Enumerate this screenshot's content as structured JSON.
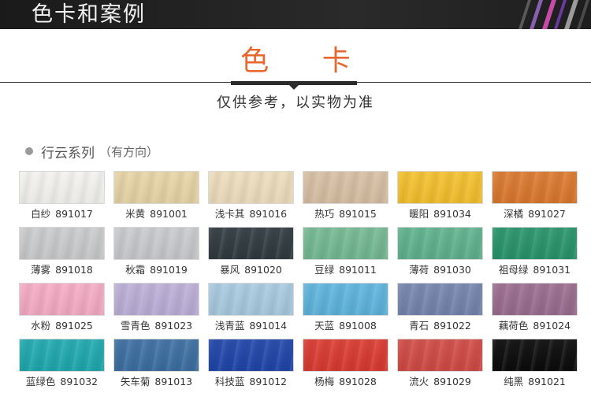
{
  "header": {
    "title": "色卡和案例"
  },
  "section": {
    "heading": "色 卡",
    "subtitle": "仅供参考，以实物为准"
  },
  "series": {
    "name": "行云系列",
    "note": "（有方向）"
  },
  "colors": [
    {
      "name": "白纱",
      "code": "891017",
      "color": "#f3f1ee"
    },
    {
      "name": "米黄",
      "code": "891001",
      "color": "#e6d3a6"
    },
    {
      "name": "浅卡其",
      "code": "891016",
      "color": "#ecdcbc"
    },
    {
      "name": "热巧",
      "code": "891015",
      "color": "#d6bea3"
    },
    {
      "name": "暖阳",
      "code": "891034",
      "color": "#f3bf2e"
    },
    {
      "name": "深橘",
      "code": "891027",
      "color": "#d9782f"
    },
    {
      "name": "薄雾",
      "code": "891018",
      "color": "#c9cacb"
    },
    {
      "name": "秋霜",
      "code": "891019",
      "color": "#c8c9cc"
    },
    {
      "name": "暴风",
      "code": "891020",
      "color": "#2f3a40"
    },
    {
      "name": "豆绿",
      "code": "891011",
      "color": "#74b892"
    },
    {
      "name": "薄荷",
      "code": "891030",
      "color": "#5fb18d"
    },
    {
      "name": "祖母绿",
      "code": "891031",
      "color": "#28936a"
    },
    {
      "name": "水粉",
      "code": "891025",
      "color": "#f3abc3"
    },
    {
      "name": "雪青色",
      "code": "891023",
      "color": "#bbaed6"
    },
    {
      "name": "浅青蓝",
      "code": "891014",
      "color": "#a8c9de"
    },
    {
      "name": "天蓝",
      "code": "891008",
      "color": "#5eb3dc"
    },
    {
      "name": "青石",
      "code": "891022",
      "color": "#7484ac"
    },
    {
      "name": "藕荷色",
      "code": "891024",
      "color": "#9a6c8e"
    },
    {
      "name": "蓝绿色",
      "code": "891032",
      "color": "#1fa8ad"
    },
    {
      "name": "矢车菊",
      "code": "891013",
      "color": "#3c6ea0"
    },
    {
      "name": "科技蓝",
      "code": "891012",
      "color": "#1f45a8"
    },
    {
      "name": "杨梅",
      "code": "891028",
      "color": "#d83a30"
    },
    {
      "name": "流火",
      "code": "891029",
      "color": "#cf4a45"
    },
    {
      "name": "纯黑",
      "code": "891021",
      "color": "#0b0b0b"
    }
  ]
}
